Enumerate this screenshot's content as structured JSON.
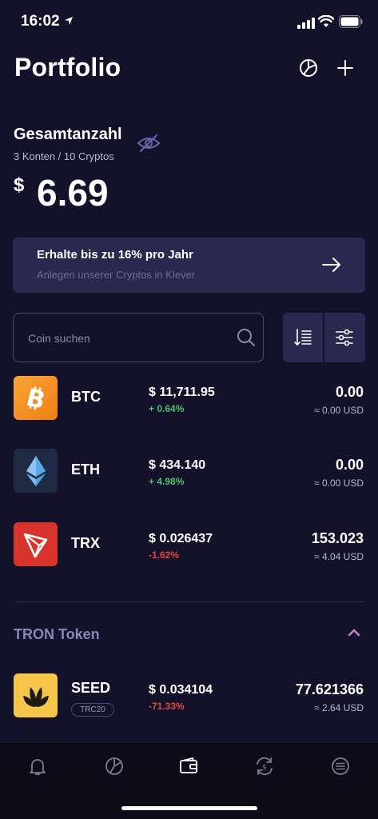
{
  "status_bar": {
    "time": "16:02"
  },
  "header": {
    "title": "Portfolio"
  },
  "summary": {
    "label": "Gesamtanzahl",
    "sub": "3 Konten / 10 Cryptos",
    "currency": "$",
    "value": "6.69"
  },
  "promo": {
    "title": "Erhalte bis zu 16% pro Jahr",
    "subtitle": "Anlegen unserer Cryptos in Klever"
  },
  "search": {
    "placeholder": "Coin suchen"
  },
  "coins": [
    {
      "symbol": "BTC",
      "price": "$ 11,711.95",
      "change": "+ 0.64%",
      "balance": "0.00",
      "fiat": "≈ 0.00 USD",
      "color": "#f7931a"
    },
    {
      "symbol": "ETH",
      "price": "$ 434.140",
      "change": "+ 4.98%",
      "balance": "0.00",
      "fiat": "≈ 0.00 USD",
      "color": "#1f2a44"
    },
    {
      "symbol": "TRX",
      "price": "$ 0.026437",
      "change": "-1.62%",
      "balance": "153.023",
      "fiat": "≈ 4.04 USD",
      "color": "#d9342b"
    }
  ],
  "token_section": {
    "title": "TRON Token",
    "tokens": [
      {
        "symbol": "SEED",
        "badge": "TRC20",
        "price": "$ 0.034104",
        "change": "-71.33%",
        "balance": "77.621366",
        "fiat": "≈ 2.64 USD",
        "color": "#f6c64a"
      }
    ]
  },
  "tabbar": {
    "tabs": [
      {
        "icon": "bell-icon"
      },
      {
        "icon": "chart-icon"
      },
      {
        "icon": "wallet-icon",
        "active": true
      },
      {
        "icon": "exchange-icon"
      },
      {
        "icon": "menu-icon"
      }
    ]
  },
  "colors": {
    "background": "#14122a",
    "card": "#2b2850",
    "positive": "#4fc06b",
    "negative": "#e0483e",
    "muted": "#8986b3"
  }
}
